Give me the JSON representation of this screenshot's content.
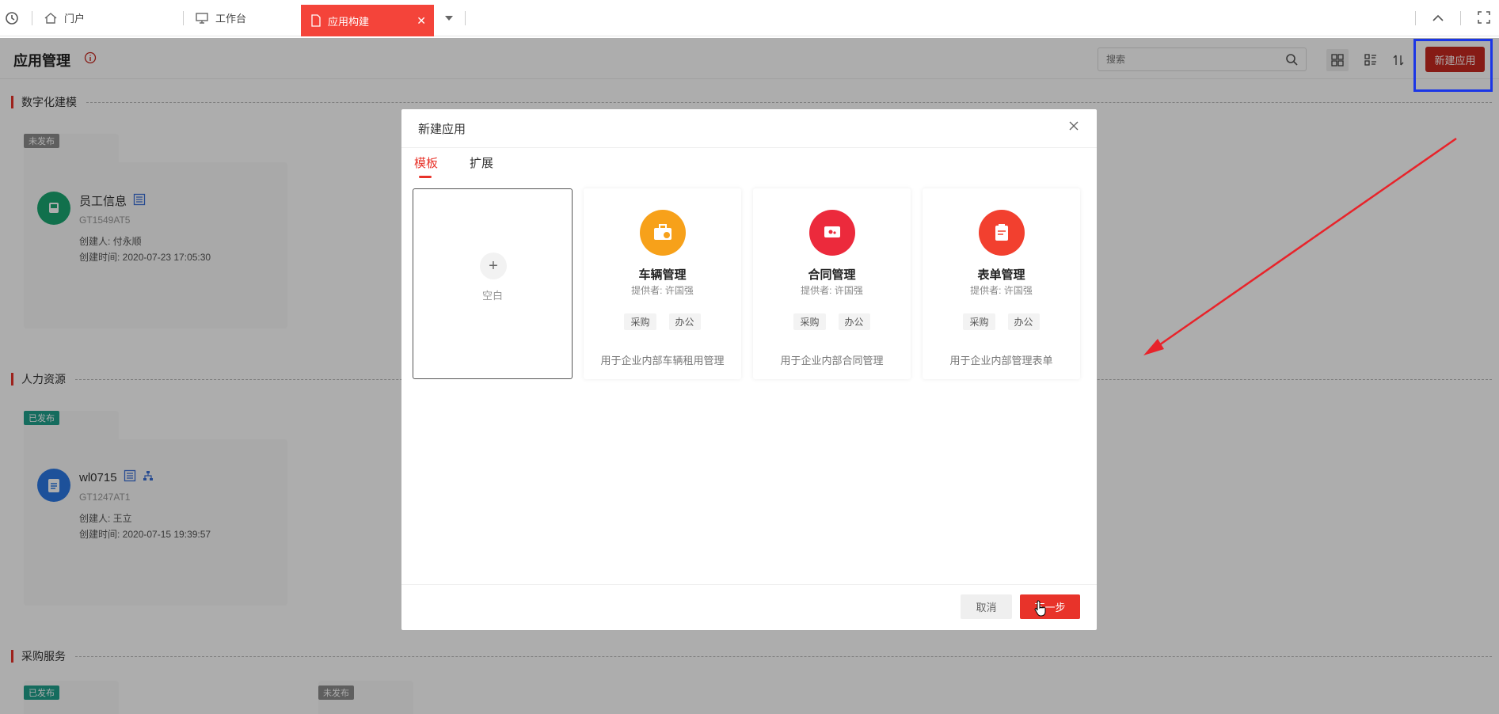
{
  "tabs": {
    "portal": "门户",
    "workbench": "工作台",
    "active": "应用构建"
  },
  "header": {
    "title": "应用管理",
    "search_placeholder": "搜索",
    "new_app_label": "新建应用"
  },
  "sections": [
    {
      "label": "数字化建模"
    },
    {
      "label": "人力资源"
    },
    {
      "label": "采购服务"
    }
  ],
  "cards": [
    {
      "status": "未发布",
      "name": "员工信息",
      "code": "GT1549AT5",
      "creator": "创建人: 付永顺",
      "time": "创建时间: 2020-07-23 17:05:30"
    },
    {
      "status": "已发布",
      "name": "wl0715",
      "code": "GT1247AT1",
      "creator": "创建人: 王立",
      "time": "创建时间: 2020-07-15 19:39:57"
    }
  ],
  "bottom_badges": [
    "已发布",
    "未发布"
  ],
  "modal": {
    "title": "新建应用",
    "tabs": [
      "模板",
      "扩展"
    ],
    "blank_label": "空白",
    "templates": [
      {
        "name": "车辆管理",
        "provider": "提供者: 许国强",
        "tags": [
          "采购",
          "办公"
        ],
        "desc": "用于企业内部车辆租用管理"
      },
      {
        "name": "合同管理",
        "provider": "提供者: 许国强",
        "tags": [
          "采购",
          "办公"
        ],
        "desc": "用于企业内部合同管理"
      },
      {
        "name": "表单管理",
        "provider": "提供者: 许国强",
        "tags": [
          "采购",
          "办公"
        ],
        "desc": "用于企业内部管理表单"
      }
    ],
    "cancel_label": "取消",
    "next_label": "下一步"
  },
  "colors": {
    "accent": "#e8332a",
    "new_btn": "#c62820",
    "highlight_box": "#1b36e6"
  }
}
